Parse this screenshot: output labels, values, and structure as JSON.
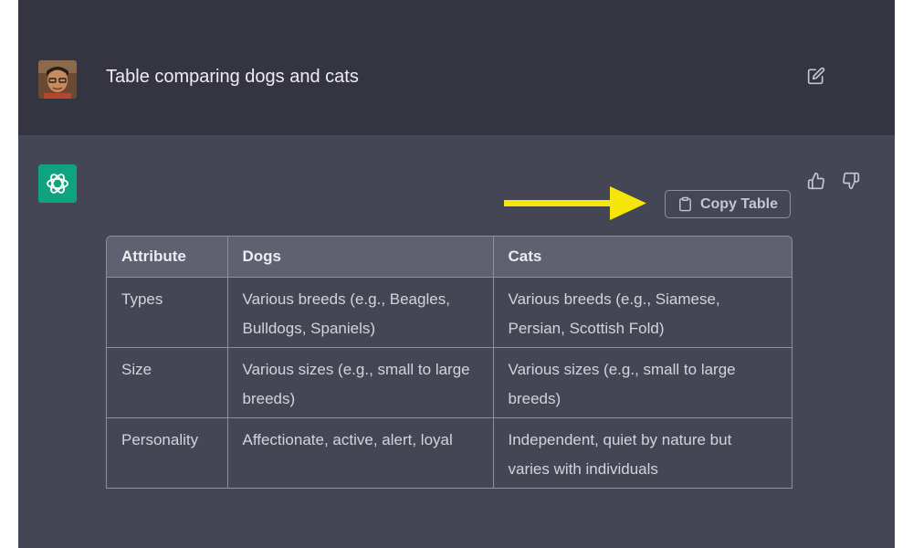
{
  "conversation": {
    "user_message": "Table comparing dogs and cats",
    "copy_button_label": "Copy Table",
    "table": {
      "headers": [
        "Attribute",
        "Dogs",
        "Cats"
      ],
      "rows": [
        [
          "Types",
          "Various breeds (e.g., Beagles, Bulldogs, Spaniels)",
          "Various breeds (e.g., Siamese, Persian, Scottish Fold)"
        ],
        [
          "Size",
          "Various sizes (e.g., small to large breeds)",
          "Various sizes (e.g., small to large breeds)"
        ],
        [
          "Personality",
          "Affectionate, active, alert, loyal",
          "Independent, quiet by nature but varies with individuals"
        ]
      ]
    }
  },
  "icons": {
    "edit": "edit-icon",
    "thumbs_up": "thumbs-up-icon",
    "thumbs_down": "thumbs-down-icon",
    "copy": "copy-icon",
    "bot_logo": "openai-logo-icon",
    "arrow": "arrow-right-icon"
  },
  "colors": {
    "user_bg": "#343541",
    "assistant_bg": "#444654",
    "bot_logo_bg": "#10a37f",
    "arrow": "#f5e50a"
  }
}
